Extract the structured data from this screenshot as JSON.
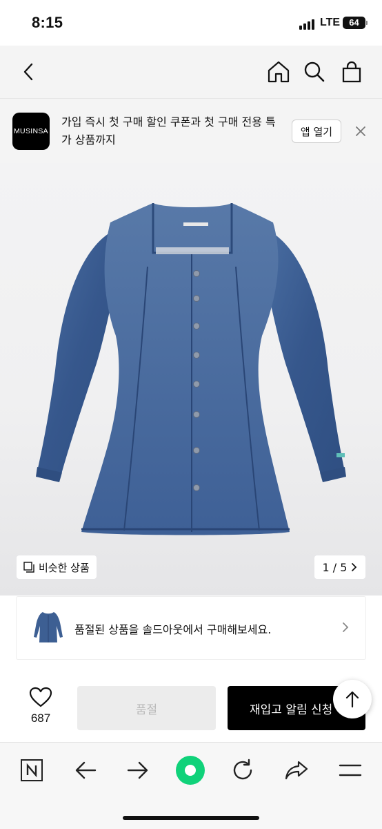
{
  "status_bar": {
    "time": "8:15",
    "network": "LTE",
    "battery": "64"
  },
  "nav": {
    "back_icon": "chevron-left-icon",
    "home_icon": "home-icon",
    "search_icon": "search-icon",
    "bag_icon": "shopping-bag-icon"
  },
  "app_banner": {
    "logo_text": "MUSINSA",
    "message": "가입 즉시 첫 구매 할인 쿠폰과 첫 구매 전용 특가 상품까지",
    "open_app_label": "앱 열기",
    "close_icon": "close-icon"
  },
  "product_image": {
    "similar_label": "비슷한 상품",
    "pager": "1 / 5"
  },
  "soldout_notice": {
    "text": "품절된 상품을 솔드아웃에서 구매해보세요."
  },
  "purchase_bar": {
    "like_count": "687",
    "soldout_label": "품절",
    "restock_label": "재입고 알림 신청"
  },
  "browser_toolbar": {
    "icons": [
      "naver-n-icon",
      "back-arrow-icon",
      "forward-arrow-icon",
      "green-dot-icon",
      "refresh-icon",
      "share-icon",
      "menu-icon"
    ]
  },
  "colors": {
    "denim": "#3d5f93",
    "brand_black": "#000000",
    "green_button": "#10d27a"
  }
}
